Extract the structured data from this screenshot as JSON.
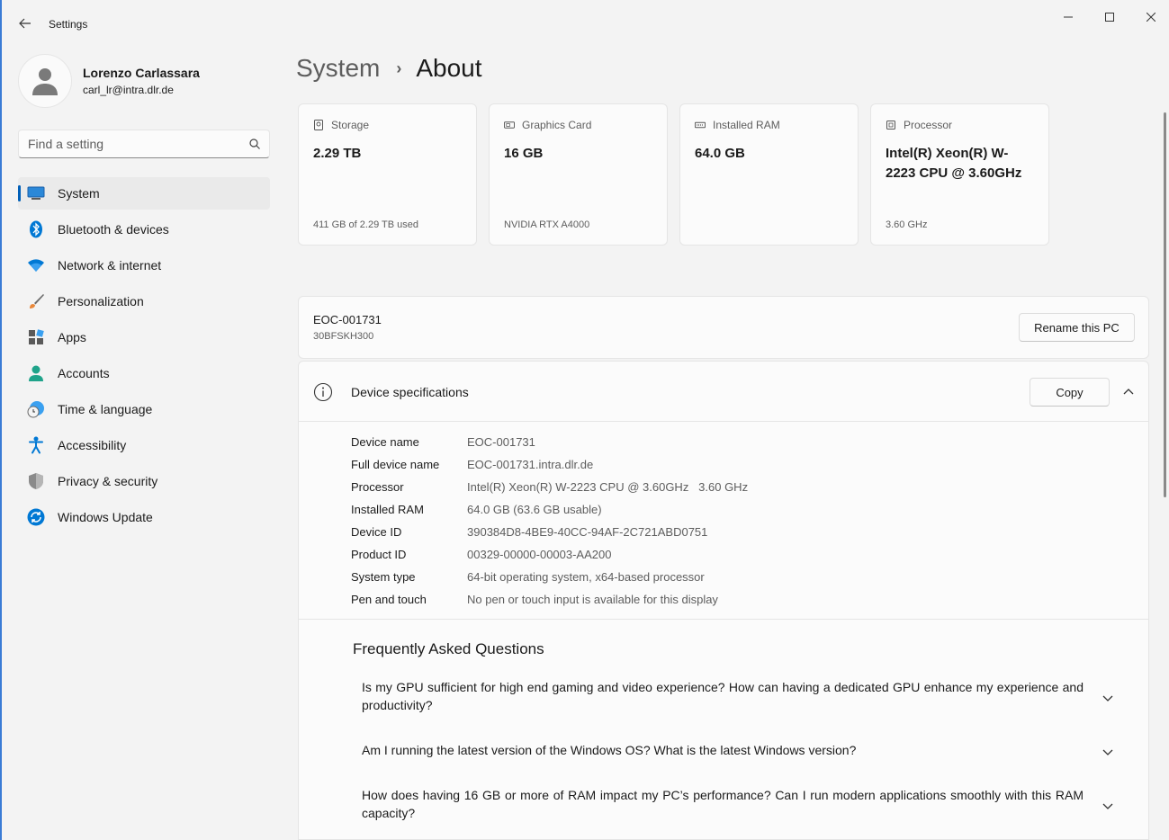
{
  "window": {
    "title": "Settings"
  },
  "controls": {
    "minimize": "—",
    "maximize": "☐",
    "close": "✕"
  },
  "profile": {
    "name": "Lorenzo Carlassara",
    "email": "carl_lr@intra.dlr.de"
  },
  "search": {
    "placeholder": "Find a setting"
  },
  "sidebar": {
    "items": [
      {
        "label": "System",
        "icon": "system-icon",
        "active": true
      },
      {
        "label": "Bluetooth & devices",
        "icon": "bluetooth-icon"
      },
      {
        "label": "Network & internet",
        "icon": "wifi-icon"
      },
      {
        "label": "Personalization",
        "icon": "brush-icon"
      },
      {
        "label": "Apps",
        "icon": "apps-icon"
      },
      {
        "label": "Accounts",
        "icon": "accounts-icon"
      },
      {
        "label": "Time & language",
        "icon": "time-language-icon"
      },
      {
        "label": "Accessibility",
        "icon": "accessibility-icon"
      },
      {
        "label": "Privacy & security",
        "icon": "shield-icon"
      },
      {
        "label": "Windows Update",
        "icon": "update-icon"
      }
    ]
  },
  "breadcrumb": {
    "parent": "System",
    "separator": "›",
    "current": "About"
  },
  "cards": [
    {
      "label": "Storage",
      "value": "2.29 TB",
      "sub": "411 GB of 2.29 TB used",
      "icon": "storage-icon"
    },
    {
      "label": "Graphics Card",
      "value": "16 GB",
      "sub": "NVIDIA RTX A4000",
      "icon": "graphics-card-icon"
    },
    {
      "label": "Installed RAM",
      "value": "64.0 GB",
      "sub": "",
      "icon": "ram-icon"
    },
    {
      "label": "Processor",
      "value": "Intel(R) Xeon(R) W-2223 CPU @ 3.60GHz",
      "sub": "3.60 GHz",
      "icon": "processor-icon"
    }
  ],
  "pc": {
    "name": "EOC-001731",
    "model": "30BFSKH300",
    "rename_label": "Rename this PC"
  },
  "specs": {
    "title": "Device specifications",
    "copy_label": "Copy",
    "rows": [
      {
        "key": "Device name",
        "value": "EOC-001731"
      },
      {
        "key": "Full device name",
        "value": "EOC-001731.intra.dlr.de"
      },
      {
        "key": "Processor",
        "value": "Intel(R) Xeon(R) W-2223 CPU @ 3.60GHz   3.60 GHz"
      },
      {
        "key": "Installed RAM",
        "value": "64.0 GB (63.6 GB usable)"
      },
      {
        "key": "Device ID",
        "value": "390384D8-4BE9-40CC-94AF-2C721ABD0751"
      },
      {
        "key": "Product ID",
        "value": "00329-00000-00003-AA200"
      },
      {
        "key": "System type",
        "value": "64-bit operating system, x64-based processor"
      },
      {
        "key": "Pen and touch",
        "value": "No pen or touch input is available for this display"
      }
    ]
  },
  "faq": {
    "title": "Frequently Asked Questions",
    "items": [
      "Is my GPU sufficient for high end gaming and video experience? How can having a dedicated GPU enhance my experience and productivity?",
      "Am I running the latest version of the Windows OS? What is the latest Windows version?",
      "How does having 16 GB or more of RAM impact my PC’s performance? Can I run modern applications smoothly with this RAM capacity?"
    ]
  },
  "colors": {
    "accent": "#005fb8",
    "background": "#f3f3f3",
    "card": "#fbfbfb"
  }
}
